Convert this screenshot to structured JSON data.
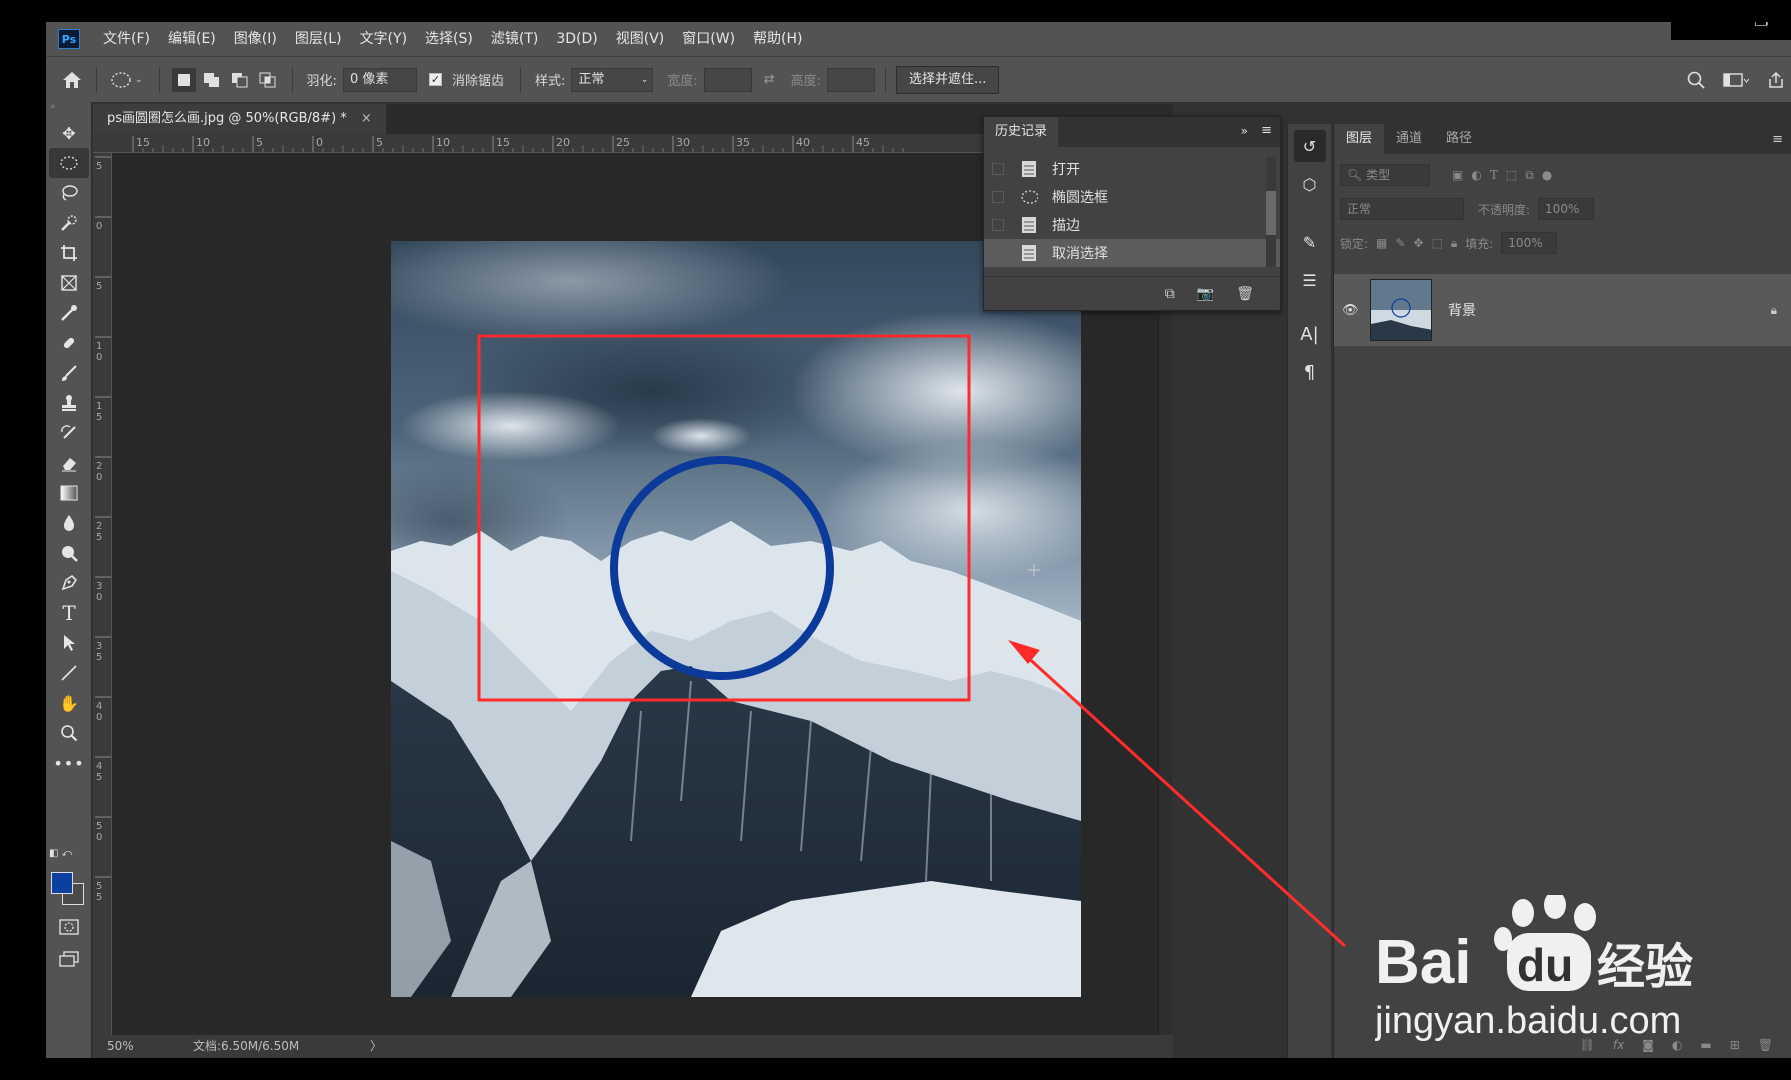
{
  "app": {
    "logo": "Ps"
  },
  "menu": [
    "文件(F)",
    "编辑(E)",
    "图像(I)",
    "图层(L)",
    "文字(Y)",
    "选择(S)",
    "滤镜(T)",
    "3D(D)",
    "视图(V)",
    "窗口(W)",
    "帮助(H)"
  ],
  "options": {
    "feather_label": "羽化:",
    "feather_value": "0 像素",
    "antialias_label": "消除锯齿",
    "style_label": "样式:",
    "style_value": "正常",
    "width_label": "宽度:",
    "height_label": "高度:",
    "select_mask_button": "选择并遮住..."
  },
  "document": {
    "tab_title": "ps画圆圈怎么画.jpg @ 50%(RGB/8#) *",
    "close": "×",
    "zoom": "50%",
    "doc_size": "文档:6.50M/6.50M",
    "status_arrow": "〉",
    "ruler_top_labels": [
      "15",
      "10",
      "5",
      "0",
      "5",
      "10",
      "15",
      "20",
      "25",
      "30",
      "35",
      "40",
      "45"
    ],
    "ruler_left_labels": [
      "5",
      "0",
      "5",
      "1 0",
      "1 5",
      "2 0",
      "2 5",
      "3 0",
      "3 5",
      "4 0",
      "4 5",
      "5 0",
      "5 5"
    ]
  },
  "history": {
    "title": "历史记录",
    "items": [
      {
        "label": "打开",
        "icon": "document-icon"
      },
      {
        "label": "椭圆选框",
        "icon": "ellipse-marquee-icon"
      },
      {
        "label": "描边",
        "icon": "document-icon"
      },
      {
        "label": "取消选择",
        "icon": "document-icon",
        "current": true
      }
    ]
  },
  "layers": {
    "tabs": [
      "图层",
      "通道",
      "路径"
    ],
    "filter_placeholder": "类型",
    "blend_mode": "正常",
    "opacity_label": "不透明度:",
    "opacity_value": "100%",
    "lock_label": "锁定:",
    "fill_label": "填充:",
    "fill_value": "100%",
    "layer_name": "背景"
  },
  "watermark": {
    "line1": "Bai",
    "line2": "经验",
    "du": "du",
    "url": "jingyan.baidu.com"
  },
  "colors": {
    "foreground": "#0d3fa0",
    "circle_stroke": "#0b3a9a",
    "annotation_red": "#ff2b2b"
  }
}
